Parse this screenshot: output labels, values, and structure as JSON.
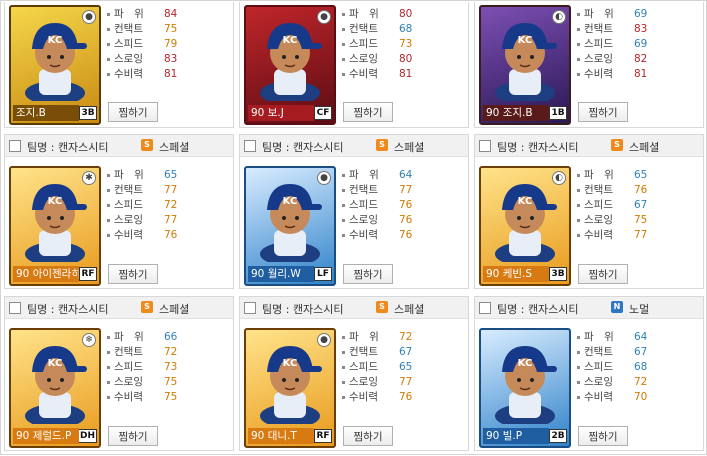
{
  "pick_label": "찜하기",
  "team_label": "팀명 : 캔자스시티",
  "cards": [
    {
      "name": "조지.B",
      "position": "3B",
      "badge": "●",
      "theme": "gold",
      "has_header": false,
      "stats": [
        {
          "label": "파　위",
          "value": "84"
        },
        {
          "label": "컨택트",
          "value": "75"
        },
        {
          "label": "스피드",
          "value": "79"
        },
        {
          "label": "스로잉",
          "value": "83"
        },
        {
          "label": "수비력",
          "value": "81"
        }
      ]
    },
    {
      "name": "90 보.J",
      "position": "CF",
      "badge": "●",
      "theme": "red",
      "has_header": false,
      "stats": [
        {
          "label": "파　위",
          "value": "80"
        },
        {
          "label": "컨택트",
          "value": "68"
        },
        {
          "label": "스피드",
          "value": "73"
        },
        {
          "label": "스로잉",
          "value": "80"
        },
        {
          "label": "수비력",
          "value": "81"
        }
      ]
    },
    {
      "name": "90 조지.B",
      "position": "1B",
      "badge": "◐",
      "theme": "purple",
      "has_header": false,
      "stats": [
        {
          "label": "파　위",
          "value": "69"
        },
        {
          "label": "컨택트",
          "value": "83"
        },
        {
          "label": "스피드",
          "value": "69"
        },
        {
          "label": "스로잉",
          "value": "82"
        },
        {
          "label": "수비력",
          "value": "81"
        }
      ]
    },
    {
      "name": "90 아이젠라히",
      "position": "RF",
      "badge": "✱",
      "theme": "orange",
      "has_header": true,
      "type": "스페셜",
      "type_code": "special",
      "stats": [
        {
          "label": "파　위",
          "value": "65"
        },
        {
          "label": "컨택트",
          "value": "77"
        },
        {
          "label": "스피드",
          "value": "72"
        },
        {
          "label": "스로잉",
          "value": "77"
        },
        {
          "label": "수비력",
          "value": "76"
        }
      ]
    },
    {
      "name": "90 월리.W",
      "position": "LF",
      "badge": "●",
      "theme": "blue",
      "has_header": true,
      "type": "스페셜",
      "type_code": "special",
      "stats": [
        {
          "label": "파　위",
          "value": "64"
        },
        {
          "label": "컨택트",
          "value": "77"
        },
        {
          "label": "스피드",
          "value": "76"
        },
        {
          "label": "스로잉",
          "value": "76"
        },
        {
          "label": "수비력",
          "value": "76"
        }
      ]
    },
    {
      "name": "90 케빈.S",
      "position": "3B",
      "badge": "◐",
      "theme": "orange",
      "has_header": true,
      "type": "스페셜",
      "type_code": "special",
      "stats": [
        {
          "label": "파　위",
          "value": "65"
        },
        {
          "label": "컨택트",
          "value": "76"
        },
        {
          "label": "스피드",
          "value": "67"
        },
        {
          "label": "스로잉",
          "value": "75"
        },
        {
          "label": "수비력",
          "value": "77"
        }
      ]
    },
    {
      "name": "90 제럴드.P",
      "position": "DH",
      "badge": "❄",
      "theme": "orange",
      "has_header": true,
      "type": "스페셜",
      "type_code": "special",
      "stats": [
        {
          "label": "파　위",
          "value": "66"
        },
        {
          "label": "컨택트",
          "value": "72"
        },
        {
          "label": "스피드",
          "value": "73"
        },
        {
          "label": "스로잉",
          "value": "75"
        },
        {
          "label": "수비력",
          "value": "75"
        }
      ]
    },
    {
      "name": "90 대니.T",
      "position": "RF",
      "badge": "●",
      "theme": "orange",
      "has_header": true,
      "type": "스페셜",
      "type_code": "special",
      "stats": [
        {
          "label": "파　위",
          "value": "72"
        },
        {
          "label": "컨택트",
          "value": "67"
        },
        {
          "label": "스피드",
          "value": "65"
        },
        {
          "label": "스로잉",
          "value": "77"
        },
        {
          "label": "수비력",
          "value": "76"
        }
      ]
    },
    {
      "name": "90 빌.P",
      "position": "2B",
      "badge": "",
      "theme": "blue",
      "has_header": true,
      "type": "노멀",
      "type_code": "normal",
      "stats": [
        {
          "label": "파　위",
          "value": "64"
        },
        {
          "label": "컨택트",
          "value": "67"
        },
        {
          "label": "스피드",
          "value": "68"
        },
        {
          "label": "스로잉",
          "value": "72"
        },
        {
          "label": "수비력",
          "value": "70"
        }
      ]
    }
  ]
}
